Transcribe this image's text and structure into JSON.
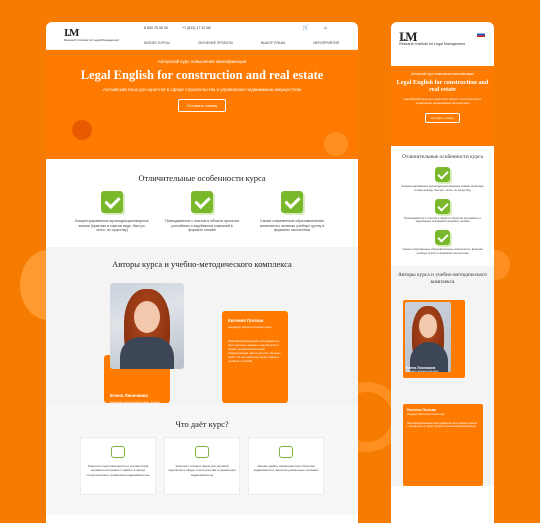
{
  "desktop": {
    "logo": {
      "mark": "I.M",
      "sub": "Research Institute for Legal Management"
    },
    "contacts": [
      "8 800 75 50 90",
      "+7 (812) 17 42 68"
    ],
    "nav": [
      "Бизнес курсы",
      "Обучение проекты",
      "Выбор Плана",
      "Мероприятия"
    ],
    "hero": {
      "pre": "Авторский курс повышения квалификации",
      "title": "Legal English for construction and real estate",
      "subtitle": "Английский язык для юристов в сфере строительства и управления недвижимым имуществом",
      "button": "Оставить заявку"
    },
    "features_title": "Отличительные особенности курса",
    "features": [
      "Концентрированные мультидисциплинарные знания (практика в сжатом виде, быстро, четко, по существу)",
      "Преподаватели с опытом в области проектов российских и зарубежных компаний в формате онлайн",
      "Самые современные образовательные компоненты: включая учебную группу в форматах экосистемы"
    ],
    "authors_title": "Авторы курса и учебно-методического комплекса",
    "author_left": {
      "name": "Елена Лисичкина",
      "role": "кандидат юридических наук, доцент"
    },
    "author_right": {
      "name": "Евгения Попова",
      "role": "кандидат филологических наук",
      "desc": "Квалифицированный преподаватель иностранных языков и переводчик в сфере профессиональной коммуникации, автор многих научных работ по английскому языку права и учебных пособий"
    },
    "gives_title": "Что даёт курс?",
    "gives": [
      "Гарантия подготовленности и соответствия нормам иностранного права и в сфере строительства и управления недвижимостью",
      "Комплект типовых форм для деловой переписки в сфере строительства и управления недвижимостью",
      "Умение давать характеристику объектам недвижимости, включая уникальные признаки"
    ]
  },
  "mobile": {
    "logo": {
      "mark": "I.M",
      "sub": "Research Institute for Legal Management"
    },
    "hero": {
      "pre": "Авторский курс повышения квалификации",
      "title": "Legal English for construction and real estate",
      "subtitle": "Английский язык для юристов в сфере строительства и управления недвижимым имуществом",
      "button": "Оставить заявку"
    },
    "features_title": "Отличительные особенности курса",
    "features": [
      "Концентрированные мультидисциплинарные знания (практика в сжатом виде, быстро, четко, по существу)",
      "Преподаватели с опытом в области проектов российских и зарубежных компаний в формате онлайн",
      "Самые современные образовательные компоненты: включая учебную группу в форматах экосистемы"
    ],
    "authors_title": "Авторы курса и учебно-методического комплекса",
    "author_left": {
      "name": "Елена Лисичкина",
      "role": "кандидат юридических наук"
    },
    "author_right": {
      "name": "Евгения Попова",
      "role": "кандидат филологических наук",
      "desc": "Квалифицированный преподаватель иностранных языков и переводчик в сфере профессиональной коммуникации"
    }
  },
  "colors": {
    "accent": "#ff7a00",
    "background": "#f57c00",
    "check": "#78b82a"
  }
}
